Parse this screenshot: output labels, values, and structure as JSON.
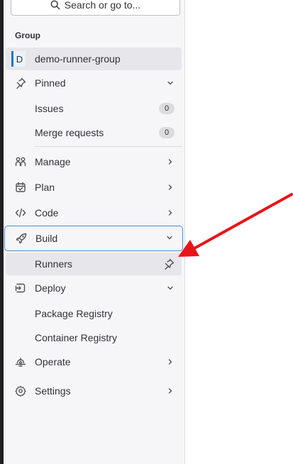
{
  "search": {
    "label": "Search or go to..."
  },
  "sidebar": {
    "section_label": "Group",
    "group": {
      "initial": "D",
      "name": "demo-runner-group"
    },
    "pinned": {
      "label": "Pinned"
    },
    "pinned_items": [
      {
        "label": "Issues",
        "count": "0"
      },
      {
        "label": "Merge requests",
        "count": "0"
      }
    ],
    "nav": [
      {
        "label": "Manage"
      },
      {
        "label": "Plan"
      },
      {
        "label": "Code"
      },
      {
        "label": "Build"
      },
      {
        "label": "Deploy"
      },
      {
        "label": "Operate"
      },
      {
        "label": "Settings"
      }
    ],
    "build_sub": [
      {
        "label": "Runners"
      }
    ],
    "deploy_sub": [
      {
        "label": "Package Registry"
      },
      {
        "label": "Container Registry"
      }
    ]
  },
  "colors": {
    "accent": "#1f75cb",
    "focus_border": "#4a8bd8",
    "annotation_arrow": "#e8141a"
  },
  "icons": [
    "search-icon",
    "pin-icon",
    "chevron-down-icon",
    "chevron-right-icon",
    "manage-icon",
    "plan-icon",
    "code-icon",
    "rocket-icon",
    "deploy-icon",
    "operate-icon",
    "settings-icon"
  ]
}
